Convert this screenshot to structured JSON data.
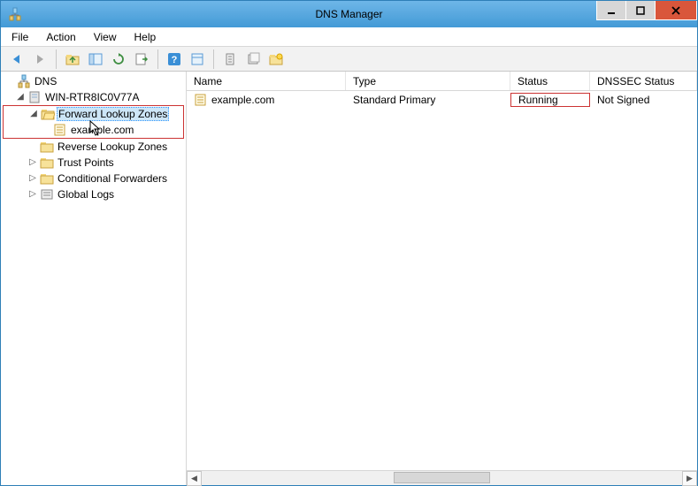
{
  "window": {
    "title": "DNS Manager"
  },
  "menu": {
    "file": "File",
    "action": "Action",
    "view": "View",
    "help": "Help"
  },
  "tree": {
    "root": "DNS",
    "server": "WIN-RTR8IC0V77A",
    "forward": "Forward Lookup Zones",
    "zone": "example.com",
    "reverse": "Reverse Lookup Zones",
    "trust": "Trust Points",
    "cond": "Conditional Forwarders",
    "logs": "Global Logs"
  },
  "columns": {
    "name": "Name",
    "type": "Type",
    "status": "Status",
    "dnssec": "DNSSEC Status"
  },
  "rows": [
    {
      "name": "example.com",
      "type": "Standard Primary",
      "status": "Running",
      "dnssec": "Not Signed"
    }
  ],
  "icons": {
    "back": "back-icon",
    "forward": "forward-icon",
    "up": "up-icon",
    "showhide": "showhide-icon",
    "refresh": "refresh-icon",
    "export": "export-icon",
    "help": "help-icon",
    "props": "props-icon",
    "col1": "col1-icon",
    "col2": "col2-icon",
    "newzone": "newzone-icon"
  }
}
